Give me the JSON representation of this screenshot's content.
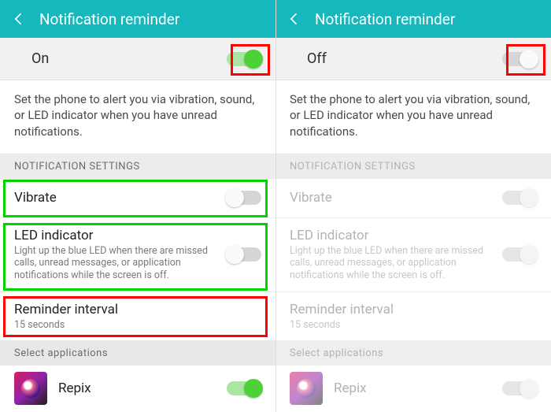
{
  "header": {
    "title": "Notification reminder"
  },
  "master": {
    "on_label": "On",
    "off_label": "Off"
  },
  "description": "Set the phone to alert you via vibration, sound, or LED indicator when you have unread notifications.",
  "section_label": "NOTIFICATION SETTINGS",
  "settings": {
    "vibrate": {
      "title": "Vibrate"
    },
    "led": {
      "title": "LED indicator",
      "sub": "Light up the blue LED when there are missed calls, unread messages, or application notifications while the screen is off."
    },
    "interval": {
      "title": "Reminder interval",
      "sub": "15 seconds"
    },
    "select_apps": {
      "title": "Select applications"
    }
  },
  "app": {
    "name": "Repix"
  }
}
